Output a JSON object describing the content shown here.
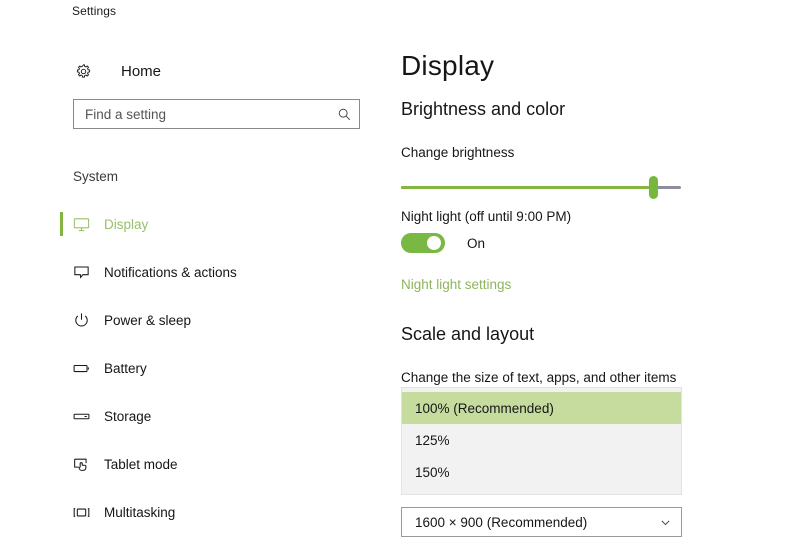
{
  "window": {
    "title": "Settings"
  },
  "sidebar": {
    "home": {
      "label": "Home",
      "icon": "gear-icon"
    },
    "search": {
      "placeholder": "Find a setting",
      "value": "",
      "icon": "search-icon"
    },
    "section_label": "System",
    "items": [
      {
        "label": "Display",
        "icon": "monitor-icon",
        "selected": true
      },
      {
        "label": "Notifications & actions",
        "icon": "speech-bubble-icon",
        "selected": false
      },
      {
        "label": "Power & sleep",
        "icon": "power-icon",
        "selected": false
      },
      {
        "label": "Battery",
        "icon": "battery-icon",
        "selected": false
      },
      {
        "label": "Storage",
        "icon": "drive-icon",
        "selected": false
      },
      {
        "label": "Tablet mode",
        "icon": "tablet-hand-icon",
        "selected": false
      },
      {
        "label": "Multitasking",
        "icon": "window-brackets-icon",
        "selected": false
      }
    ]
  },
  "main": {
    "page_title": "Display",
    "brightness_section": {
      "heading": "Brightness and color",
      "brightness_label": "Change brightness",
      "slider_percent": 90,
      "night_light_label": "Night light (off until 9:00 PM)",
      "night_light_state": "On",
      "night_light_on": true,
      "night_light_link": "Night light settings"
    },
    "scale_section": {
      "heading": "Scale and layout",
      "scale_hint": "Change the size of text, apps, and other items",
      "scale_options": [
        {
          "label": "100% (Recommended)",
          "selected": true
        },
        {
          "label": "125%",
          "selected": false
        },
        {
          "label": "150%",
          "selected": false
        }
      ],
      "resolution_value": "1600 × 900 (Recommended)",
      "resolution_chevron": "chevron-down-icon"
    }
  },
  "colors": {
    "accent_green": "#86b440",
    "toggle_green": "#79b842",
    "link_green": "#8fb45f",
    "selected_nav_green": "#9bbf6a",
    "highlight_green": "#c6dc9f",
    "list_bg": "#f2f2f2"
  }
}
